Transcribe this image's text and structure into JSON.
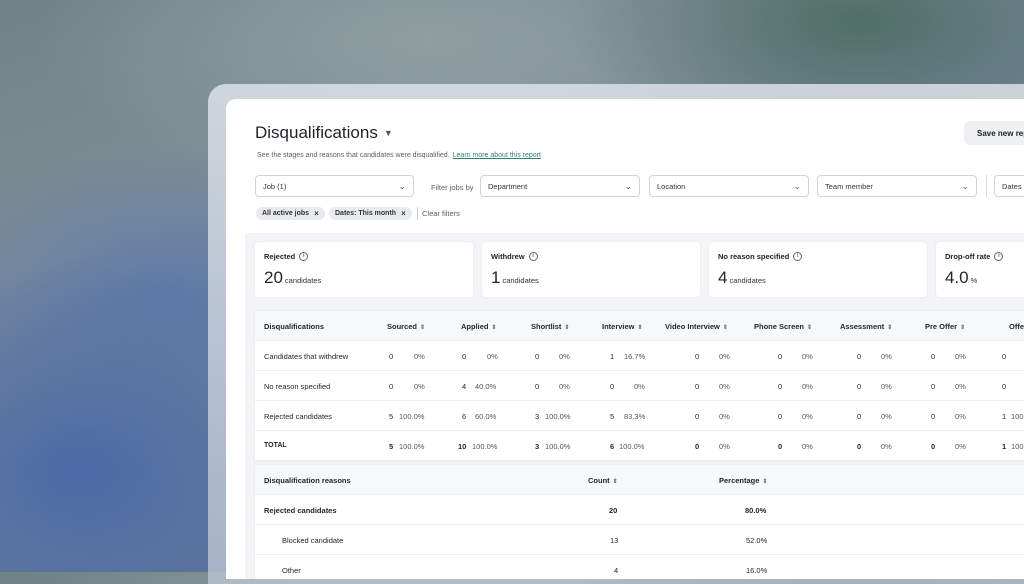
{
  "page": {
    "title": "Disqualifications",
    "subtitle": "See the stages and reasons that candidates were disqualified.",
    "learn_more": "Learn more about this report",
    "save_button": "Save new rep"
  },
  "filters": {
    "job": "Job (1)",
    "filter_label": "Filter jobs by",
    "department": "Department",
    "location": "Location",
    "team_member": "Team member",
    "dates": "Dates",
    "chips": [
      "All active jobs",
      "Dates: This month"
    ],
    "clear": "Clear filters"
  },
  "cards": [
    {
      "label": "Rejected",
      "value": "20",
      "unit": "candidates"
    },
    {
      "label": "Withdrew",
      "value": "1",
      "unit": "candidates"
    },
    {
      "label": "No reason specified",
      "value": "4",
      "unit": "candidates"
    },
    {
      "label": "Drop-off rate",
      "value": "4.0",
      "unit": "%"
    }
  ],
  "stage_table": {
    "headers": [
      "Disqualifications",
      "Sourced",
      "Applied",
      "Shortlist",
      "Interview",
      "Video Interview",
      "Phone Screen",
      "Assessment",
      "Pre Offer",
      "Offe"
    ],
    "rows": [
      {
        "label": "Candidates that withdrew",
        "cells": [
          [
            "0",
            "0%"
          ],
          [
            "0",
            "0%"
          ],
          [
            "0",
            "0%"
          ],
          [
            "1",
            "16.7%"
          ],
          [
            "0",
            "0%"
          ],
          [
            "0",
            "0%"
          ],
          [
            "0",
            "0%"
          ],
          [
            "0",
            "0%"
          ],
          [
            "0",
            ""
          ]
        ]
      },
      {
        "label": "No reason specified",
        "cells": [
          [
            "0",
            "0%"
          ],
          [
            "4",
            "40.0%"
          ],
          [
            "0",
            "0%"
          ],
          [
            "0",
            "0%"
          ],
          [
            "0",
            "0%"
          ],
          [
            "0",
            "0%"
          ],
          [
            "0",
            "0%"
          ],
          [
            "0",
            "0%"
          ],
          [
            "0",
            ""
          ]
        ]
      },
      {
        "label": "Rejected candidates",
        "cells": [
          [
            "5",
            "100.0%"
          ],
          [
            "6",
            "60.0%"
          ],
          [
            "3",
            "100.0%"
          ],
          [
            "5",
            "83.3%"
          ],
          [
            "0",
            "0%"
          ],
          [
            "0",
            "0%"
          ],
          [
            "0",
            "0%"
          ],
          [
            "0",
            "0%"
          ],
          [
            "1",
            "100"
          ]
        ]
      },
      {
        "label": "TOTAL",
        "cells": [
          [
            "5",
            "100.0%"
          ],
          [
            "10",
            "100.0%"
          ],
          [
            "3",
            "100.0%"
          ],
          [
            "6",
            "100.0%"
          ],
          [
            "0",
            "0%"
          ],
          [
            "0",
            "0%"
          ],
          [
            "0",
            "0%"
          ],
          [
            "0",
            "0%"
          ],
          [
            "1",
            "100"
          ]
        ]
      }
    ]
  },
  "reasons_table": {
    "headers": [
      "Disqualification reasons",
      "Count",
      "Percentage"
    ],
    "rows": [
      {
        "label": "Rejected candidates",
        "count": "20",
        "pct": "80.0%"
      },
      {
        "label": "Blocked candidate",
        "count": "13",
        "pct": "52.0%"
      },
      {
        "label": "Other",
        "count": "4",
        "pct": "16.0%"
      }
    ]
  }
}
